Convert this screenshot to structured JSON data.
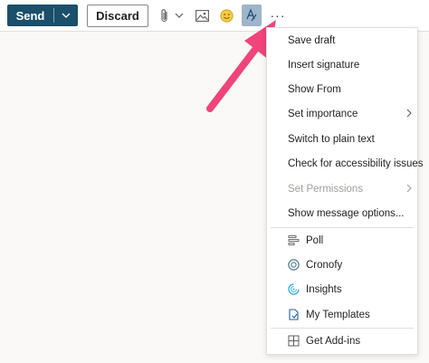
{
  "toolbar": {
    "send_label": "Send",
    "discard_label": "Discard",
    "more_label": "···"
  },
  "menu": {
    "items": [
      {
        "label": "Save draft"
      },
      {
        "label": "Insert signature"
      },
      {
        "label": "Show From"
      },
      {
        "label": "Set importance"
      },
      {
        "label": "Switch to plain text"
      },
      {
        "label": "Check for accessibility issues"
      },
      {
        "label": "Set Permissions"
      },
      {
        "label": "Show message options..."
      }
    ],
    "addins": [
      {
        "label": "Poll",
        "icon": "poll-icon"
      },
      {
        "label": "Cronofy",
        "icon": "cronofy-icon"
      },
      {
        "label": "Insights",
        "icon": "insights-icon"
      },
      {
        "label": "My Templates",
        "icon": "templates-icon"
      }
    ],
    "get_addins": {
      "label": "Get Add-ins",
      "icon": "get-addins-icon"
    }
  },
  "colors": {
    "send": "#1b4f6a",
    "format_highlight": "#9fb5c9",
    "arrow": "#f0447a",
    "disabled_text": "#a19f9d"
  }
}
